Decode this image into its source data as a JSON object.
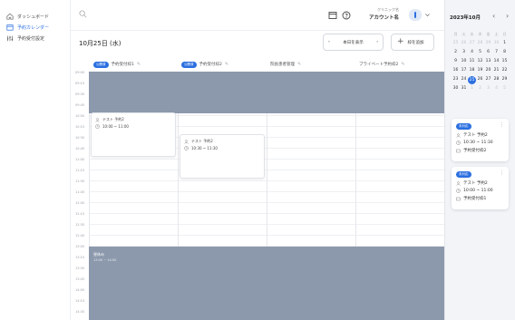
{
  "sidebar": {
    "items": [
      {
        "label": "ダッシュボード",
        "icon": "home-icon"
      },
      {
        "label": "予約カレンダー",
        "icon": "calendar-icon"
      },
      {
        "label": "予約受付設定",
        "icon": "settings-sliders-icon"
      }
    ]
  },
  "header": {
    "clinic_label": "クリニック名",
    "account_name": "アカウント名"
  },
  "toolbar": {
    "date_title": "10月25日 (水)",
    "show_label": "本日を表示",
    "add_label": "枠を追加"
  },
  "columns": [
    {
      "label": "予約受付枠1",
      "badge": "公開済"
    },
    {
      "label": "予約受付枠2",
      "badge": "公開済"
    },
    {
      "label": "院長患者管理",
      "badge": ""
    },
    {
      "label": "プライベート予約枠2",
      "badge": ""
    }
  ],
  "times": [
    "09:00",
    "09:15",
    "09:30",
    "09:45",
    "10:00",
    "10:15",
    "10:30",
    "10:45",
    "11:00",
    "11:15",
    "11:30",
    "11:45",
    "12:00",
    "12:15",
    "12:30",
    "12:45",
    "13:00",
    "13:15",
    "13:30",
    "13:45",
    "14:00",
    "14:15",
    "14:30"
  ],
  "blocked_break": {
    "label": "昼休み",
    "time": "13:00 ~ 14:00"
  },
  "events": [
    {
      "patient": "テスト 予約2",
      "time": "10:00 ~ 11:00"
    },
    {
      "patient": "テスト 予約2",
      "time": "10:30 ~ 11:30"
    }
  ],
  "minical": {
    "title": "2023年10月",
    "weekdays": [
      "月",
      "火",
      "水",
      "木",
      "金",
      "土",
      "日"
    ],
    "weeks": [
      [
        "25",
        "26",
        "27",
        "28",
        "29",
        "30",
        "1"
      ],
      [
        "2",
        "3",
        "4",
        "5",
        "6",
        "7",
        "8"
      ],
      [
        "9",
        "10",
        "11",
        "12",
        "13",
        "14",
        "15"
      ],
      [
        "16",
        "17",
        "18",
        "19",
        "20",
        "21",
        "22"
      ],
      [
        "23",
        "24",
        "25",
        "26",
        "27",
        "28",
        "29"
      ],
      [
        "30",
        "31",
        "1",
        "2",
        "3",
        "4",
        "5"
      ]
    ],
    "selected": "25"
  },
  "cards": [
    {
      "badge": "未対応",
      "patient": "テスト 予約2",
      "time": "10:30 ~ 11:30",
      "slot": "予約受付枠2"
    },
    {
      "badge": "未対応",
      "patient": "テスト 予約2",
      "time": "10:00 ~ 11:00",
      "slot": "予約受付枠1"
    }
  ],
  "colors": {
    "accent": "#2b6fe0",
    "blocked": "#8c99ad"
  }
}
